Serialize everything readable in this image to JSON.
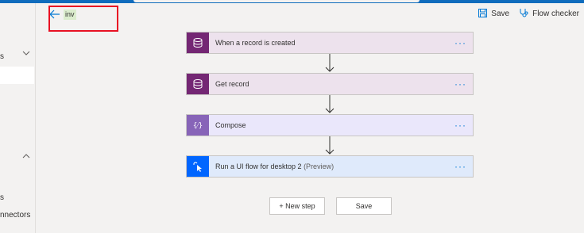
{
  "header": {
    "flow_title": "inv",
    "save_label": "Save",
    "flow_checker_label": "Flow checker"
  },
  "sidebar": {
    "items": [
      {
        "label": "s"
      },
      {
        "label": "s"
      },
      {
        "label": "nnectors"
      }
    ]
  },
  "steps": [
    {
      "label": "When a record is created",
      "icon": "dataverse-icon",
      "color": "#742774"
    },
    {
      "label": "Get record",
      "icon": "dataverse-icon",
      "color": "#742774"
    },
    {
      "label": "Compose",
      "icon": "compose-icon",
      "color": "#8764b8"
    },
    {
      "label": "Run a UI flow for desktop 2",
      "sub": " (Preview)",
      "icon": "ui-flow-icon",
      "color": "#0066ff"
    }
  ],
  "actions": {
    "new_step_label": "+ New step",
    "save_label": "Save"
  }
}
